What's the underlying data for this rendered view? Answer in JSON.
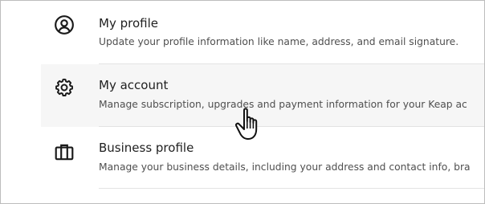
{
  "items": [
    {
      "title": "My profile",
      "description": "Update your profile information like name, address, and email signature.",
      "icon": "user-circle-icon"
    },
    {
      "title": "My account",
      "description": "Manage subscription, upgrades and payment information for your Keap ac",
      "icon": "gear-icon"
    },
    {
      "title": "Business profile",
      "description": "Manage your business details, including your address and contact info, bra",
      "icon": "briefcase-icon"
    }
  ],
  "colors": {
    "hover_background": "#f6f6f6",
    "divider": "#e3e3e3",
    "border": "#bdbdbd"
  }
}
